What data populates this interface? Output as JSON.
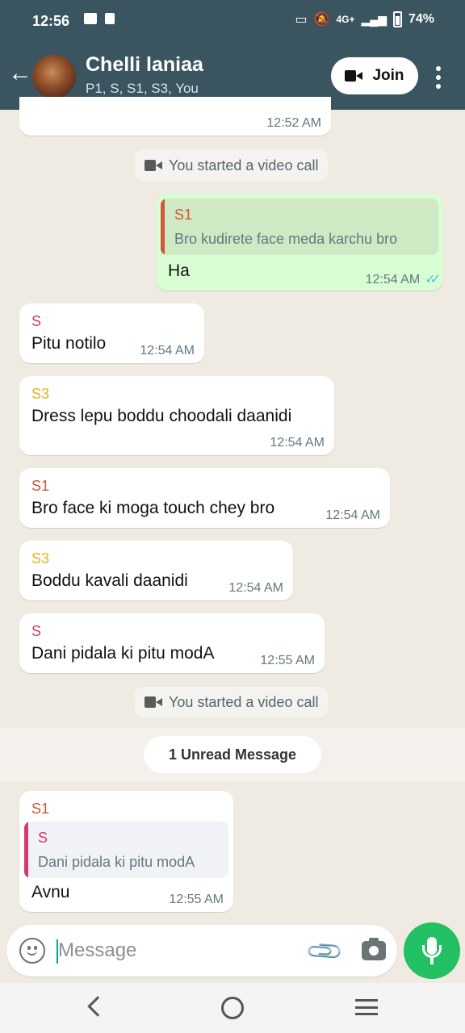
{
  "status_bar": {
    "time": "12:56",
    "network": "4G+",
    "battery": "74%"
  },
  "header": {
    "title": "Chelli laniaa",
    "subtitle": "P1, S, S1, S3, You",
    "join_label": "Join"
  },
  "colors": {
    "header_bg": "#3b5560",
    "outgoing_bubble": "#d9fdd3",
    "accent_green": "#21c063",
    "read_ticks": "#53bdeb",
    "sender_S": "#d3396d",
    "sender_S1": "#d0573a",
    "sender_S3": "#e3b51c"
  },
  "messages": [
    {
      "type": "incoming",
      "partial": true,
      "time": "12:52 AM"
    },
    {
      "type": "system",
      "icon": "video-call-icon",
      "text": "You started a video call"
    },
    {
      "type": "outgoing",
      "quote": {
        "sender": "S1",
        "text": "Bro kudirete face meda karchu bro"
      },
      "text": "Ha",
      "time": "12:54 AM",
      "status": "read"
    },
    {
      "type": "incoming",
      "sender": "S",
      "text": "Pitu notilo",
      "time": "12:54 AM"
    },
    {
      "type": "incoming",
      "sender": "S3",
      "text": "Dress lepu boddu choodali daanidi",
      "time": "12:54 AM"
    },
    {
      "type": "incoming",
      "sender": "S1",
      "text": "Bro face ki moga touch chey bro",
      "time": "12:54 AM"
    },
    {
      "type": "incoming",
      "sender": "S3",
      "text": "Boddu kavali daanidi",
      "time": "12:54 AM"
    },
    {
      "type": "incoming",
      "sender": "S",
      "text": "Dani pidala ki pitu modA",
      "time": "12:55 AM"
    },
    {
      "type": "system",
      "icon": "video-call-icon",
      "text": "You started a video call"
    },
    {
      "type": "incoming",
      "sender": "S1",
      "quote": {
        "sender": "S",
        "text": "Dani pidala ki pitu modA"
      },
      "text": "Avnu",
      "time": "12:55 AM"
    }
  ],
  "unread_label": "1 Unread Message",
  "composer": {
    "placeholder": "Message",
    "value": ""
  }
}
